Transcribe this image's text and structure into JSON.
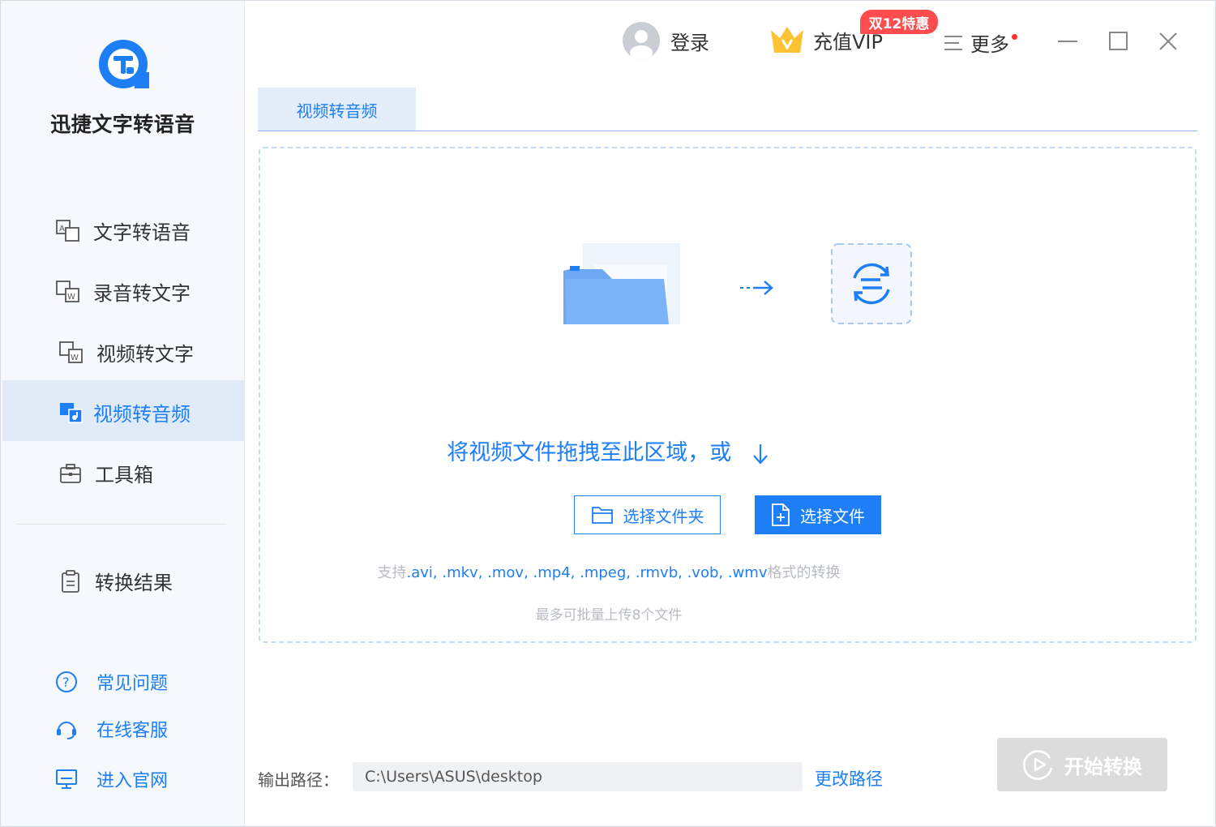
{
  "app": {
    "name": "迅捷文字转语音"
  },
  "sidebar": {
    "items": [
      {
        "label": "文字转语音",
        "icon": "text-to-speech-icon"
      },
      {
        "label": "录音转文字",
        "icon": "audio-to-text-icon"
      },
      {
        "label": "视频转文字",
        "icon": "video-to-text-icon"
      },
      {
        "label": "视频转音频",
        "icon": "video-to-audio-icon",
        "active": true
      },
      {
        "label": "工具箱",
        "icon": "toolbox-icon"
      }
    ],
    "result": {
      "label": "转换结果",
      "icon": "clipboard-icon"
    },
    "help": [
      {
        "label": "常见问题",
        "icon": "question-icon"
      },
      {
        "label": "在线客服",
        "icon": "headset-icon"
      },
      {
        "label": "进入官网",
        "icon": "monitor-icon"
      }
    ]
  },
  "topbar": {
    "login": "登录",
    "vip": "充值VIP",
    "promo": "双12特惠",
    "more": "更多"
  },
  "tab": {
    "label": "视频转音频"
  },
  "dropzone": {
    "text": "将视频文件拖拽至此区域，或",
    "btn_folder": "选择文件夹",
    "btn_file": "选择文件",
    "support_prefix": "支持",
    "support_formats": ".avi, .mkv, .mov, .mp4, .mpeg, .rmvb, .vob, .wmv",
    "support_suffix": "格式的转换",
    "limit": "最多可批量上传8个文件"
  },
  "output": {
    "label": "输出路径：",
    "path": "C:\\Users\\ASUS\\desktop",
    "change": "更改路径"
  },
  "start": {
    "label": "开始转换"
  },
  "colors": {
    "accent": "#1d7ef5",
    "promo": "#ff4d4f",
    "sidebar_bg": "#f5f8fc",
    "active_bg": "#e1ebf7"
  }
}
